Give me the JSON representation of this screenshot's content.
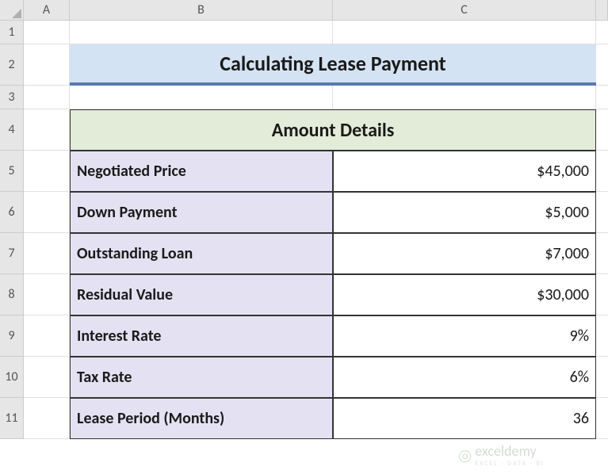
{
  "columns": [
    "A",
    "B",
    "C"
  ],
  "rows": [
    "1",
    "2",
    "3",
    "4",
    "5",
    "6",
    "7",
    "8",
    "9",
    "10",
    "11"
  ],
  "title": "Calculating Lease Payment",
  "section_header": "Amount Details",
  "details": [
    {
      "label": "Negotiated Price",
      "value": "$45,000"
    },
    {
      "label": "Down Payment",
      "value": "$5,000"
    },
    {
      "label": "Outstanding Loan",
      "value": "$7,000"
    },
    {
      "label": "Residual Value",
      "value": "$30,000"
    },
    {
      "label": "Interest Rate",
      "value": "9%"
    },
    {
      "label": "Tax Rate",
      "value": "6%"
    },
    {
      "label": "Lease Period (Months)",
      "value": "36"
    }
  ],
  "watermark": {
    "brand": "exceldemy",
    "tagline": "EXCEL · DATA · BI"
  },
  "chart_data": {
    "type": "table",
    "title": "Calculating Lease Payment",
    "section": "Amount Details",
    "rows": [
      {
        "field": "Negotiated Price",
        "value": 45000,
        "unit": "USD"
      },
      {
        "field": "Down Payment",
        "value": 5000,
        "unit": "USD"
      },
      {
        "field": "Outstanding Loan",
        "value": 7000,
        "unit": "USD"
      },
      {
        "field": "Residual Value",
        "value": 30000,
        "unit": "USD"
      },
      {
        "field": "Interest Rate",
        "value": 9,
        "unit": "%"
      },
      {
        "field": "Tax Rate",
        "value": 6,
        "unit": "%"
      },
      {
        "field": "Lease Period (Months)",
        "value": 36,
        "unit": "months"
      }
    ]
  }
}
